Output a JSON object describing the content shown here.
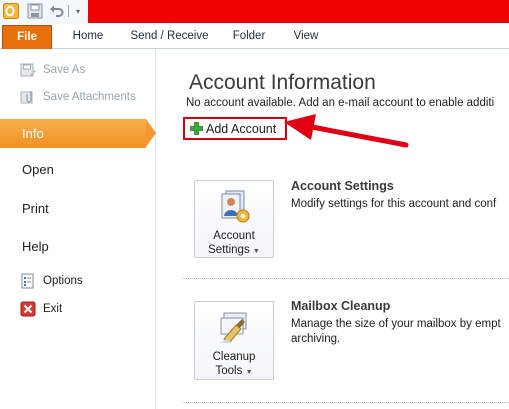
{
  "ribbon": {
    "tabs": [
      "File",
      "Home",
      "Send / Receive",
      "Folder",
      "View"
    ],
    "active_tab": "File"
  },
  "colors": {
    "title_bar_red": "#ee0000",
    "file_tab": "#e76f0c",
    "selected_nav": "#f3982c",
    "highlight_red": "#d4000f"
  },
  "sidebar": {
    "save_as": "Save As",
    "save_attachments": "Save Attachments",
    "info": "Info",
    "open": "Open",
    "print": "Print",
    "help": "Help",
    "options": "Options",
    "exit": "Exit"
  },
  "main": {
    "heading": "Account Information",
    "no_account_text": "No account available. Add an e-mail account to enable additi",
    "add_account_label": "Add Account",
    "account_settings": {
      "button_line1": "Account",
      "button_line2": "Settings",
      "title": "Account Settings",
      "description": "Modify settings for this account and conf"
    },
    "mailbox_cleanup": {
      "button_line1": "Cleanup",
      "button_line2": "Tools",
      "title": "Mailbox Cleanup",
      "description_line1": "Manage the size of your mailbox by empt",
      "description_line2": "archiving."
    }
  },
  "icons": {
    "app_logo": "outlook-logo-icon",
    "save": "save-icon",
    "undo": "undo-icon",
    "qat_customize": "dropdown-icon",
    "save_as": "save-as-icon",
    "save_attachments": "attachment-icon",
    "options": "options-icon",
    "exit": "exit-icon",
    "add": "plus-icon",
    "account_settings": "account-settings-icon",
    "cleanup": "cleanup-tools-icon",
    "annotation_arrow": "red-arrow-icon"
  }
}
